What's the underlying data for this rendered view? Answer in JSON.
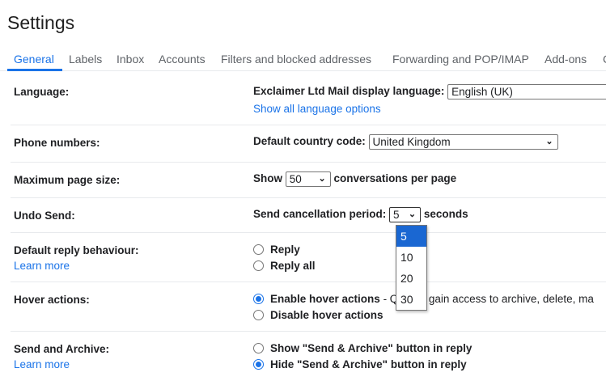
{
  "title": "Settings",
  "tabs": [
    "General",
    "Labels",
    "Inbox",
    "Accounts",
    "Filters and blocked addresses",
    "Forwarding and POP/IMAP",
    "Add-ons",
    "C"
  ],
  "language": {
    "label": "Language:",
    "text": "Exclaimer Ltd Mail display language:",
    "value": "English (UK)",
    "link": "Show all language options"
  },
  "phone": {
    "label": "Phone numbers:",
    "text": "Default country code:",
    "value": "United Kingdom"
  },
  "page_size": {
    "label": "Maximum page size:",
    "prefix": "Show",
    "value": "50",
    "suffix": "conversations per page"
  },
  "undo": {
    "label": "Undo Send:",
    "text": "Send cancellation period:",
    "value": "5",
    "suffix": "seconds",
    "options": [
      "5",
      "10",
      "20",
      "30"
    ]
  },
  "reply": {
    "label": "Default reply behaviour:",
    "learn_more": "Learn more",
    "options": [
      "Reply",
      "Reply all"
    ]
  },
  "hover": {
    "label": "Hover actions:",
    "options": [
      "Enable hover actions",
      "Disable hover actions"
    ],
    "desc": "- Quickly gain access to archive, delete, ma"
  },
  "send_archive": {
    "label": "Send and Archive:",
    "learn_more": "Learn more",
    "options": [
      "Show \"Send & Archive\" button in reply",
      "Hide \"Send & Archive\" button in reply"
    ]
  }
}
